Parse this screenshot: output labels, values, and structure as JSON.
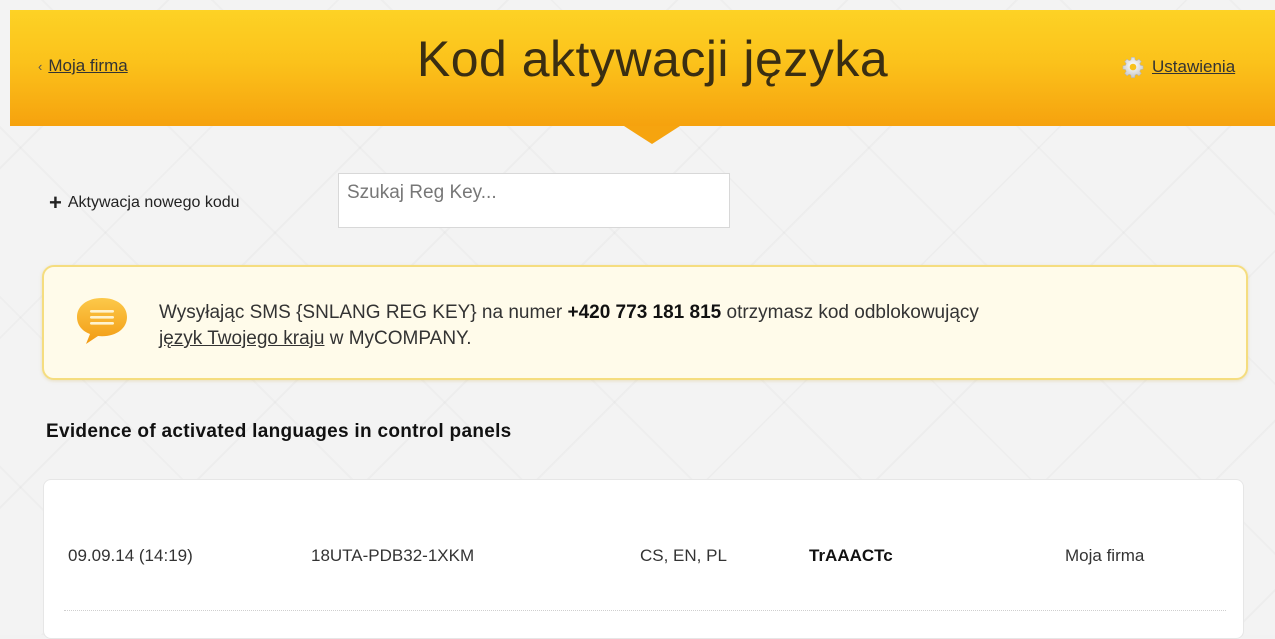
{
  "header": {
    "back_chevron": "‹",
    "back_label": "Moja firma",
    "title": "Kod aktywacji języka",
    "settings_label": "Ustawienia",
    "settings_icon": "gear-icon",
    "colors": {
      "top": "#fdd225",
      "bottom": "#f6a20e"
    }
  },
  "toolbar": {
    "new_code_plus": "+",
    "new_code_label": "Aktywacja nowego kodu",
    "search_placeholder": "Szukaj Reg Key...",
    "search_value": ""
  },
  "notice": {
    "icon": "chat-bubble-icon",
    "text_before": "Wysyłając SMS {SNLANG REG KEY} na numer ",
    "phone": "+420 773 181 815",
    "text_after": " otrzymasz kod odblokowujący",
    "link_text": "język Twojego kraju",
    "text_end": " w MyCOMPANY."
  },
  "section": {
    "title": "Evidence of activated languages in control panels"
  },
  "table": {
    "rows": [
      {
        "date": "09.09.14 (14:19)",
        "reg_key": "18UTA-PDB32-1XKM",
        "languages": "CS, EN, PL",
        "code": "TrAAACTc",
        "company": "Moja firma"
      }
    ]
  }
}
